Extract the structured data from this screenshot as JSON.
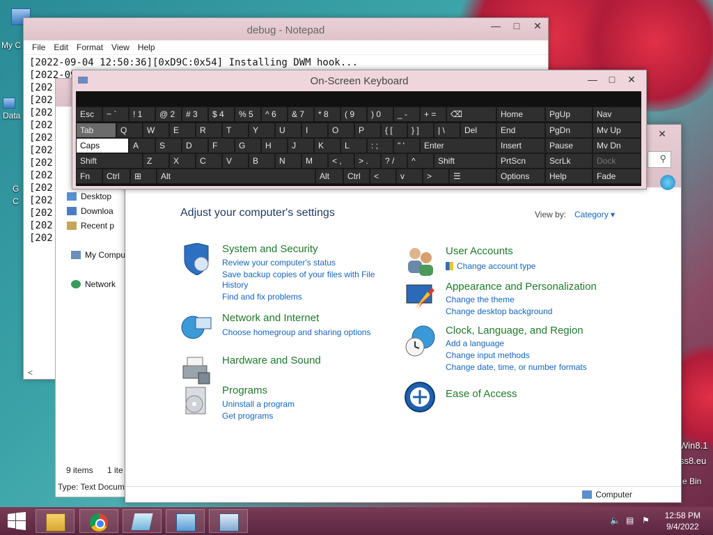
{
  "desktop": {
    "icons": [
      {
        "label": "My C"
      },
      {
        "label": "Data"
      },
      {
        "label": "G"
      },
      {
        "label": "C"
      }
    ],
    "side_text": [
      "Win8.1",
      "ss8.eu",
      "e Bin"
    ]
  },
  "notepad": {
    "title": "debug - Notepad",
    "menu": [
      "File",
      "Edit",
      "Format",
      "View",
      "Help"
    ],
    "lines": [
      "[2022-09-04 12:50:36][0xD9C:0x54] Installing DWM hook...",
      "[2022-09",
      "[202",
      "[202",
      "[202",
      "[202",
      "[202",
      "[202",
      "[202",
      "[202",
      "[202",
      "[202",
      "[202",
      "[202",
      "[202"
    ],
    "scroll_left": "<"
  },
  "explorer": {
    "nav": [
      "Desktop",
      "Downloa",
      "Recent p",
      "My Compu",
      "Network"
    ],
    "status_items": "9 items",
    "status_sel": "1 ite",
    "type_info": "Type: Text Docum"
  },
  "control_panel": {
    "heading": "Adjust your computer's settings",
    "view_by_label": "View by:",
    "view_by_value": "Category",
    "categories_left": [
      {
        "title": "System and Security",
        "links": [
          "Review your computer's status",
          "Save backup copies of your files with File",
          "History",
          "Find and fix problems"
        ]
      },
      {
        "title": "Network and Internet",
        "links": [
          "Choose homegroup and sharing options"
        ]
      },
      {
        "title": "Hardware and Sound",
        "links": []
      },
      {
        "title": "Programs",
        "links": [
          "Uninstall a program",
          "Get programs"
        ]
      }
    ],
    "categories_right": [
      {
        "title": "User Accounts",
        "links": [
          "Change account type"
        ]
      },
      {
        "title": "Appearance and Personalization",
        "links": [
          "Change the theme",
          "Change desktop background"
        ]
      },
      {
        "title": "Clock, Language, and Region",
        "links": [
          "Add a language",
          "Change input methods",
          "Change date, time, or number formats"
        ]
      },
      {
        "title": "Ease of Access",
        "links": []
      }
    ],
    "status_computer": "Computer"
  },
  "osk": {
    "title": "On-Screen Keyboard",
    "row1": [
      "Esc",
      "~ `",
      "! 1",
      "@ 2",
      "# 3",
      "$ 4",
      "% 5",
      "^ 6",
      "& 7",
      "* 8",
      "( 9",
      ") 0",
      "_ -",
      "+ ="
    ],
    "row2": [
      "Tab",
      "Q",
      "W",
      "E",
      "R",
      "T",
      "Y",
      "U",
      "I",
      "O",
      "P",
      "{ [",
      "} ]",
      "| \\",
      "Del"
    ],
    "row3": [
      "Caps",
      "A",
      "S",
      "D",
      "F",
      "G",
      "H",
      "J",
      "K",
      "L",
      ": ;",
      "\" '",
      "Enter"
    ],
    "row4": [
      "Shift",
      "Z",
      "X",
      "C",
      "V",
      "B",
      "N",
      "M",
      "< ,",
      "> .",
      "? /",
      "^",
      "Shift"
    ],
    "row5": [
      "Fn",
      "Ctrl",
      "⊞",
      "Alt",
      "Alt",
      "Ctrl",
      "<",
      "v",
      ">",
      "☰"
    ],
    "nav_keys": [
      "Home",
      "PgUp",
      "Nav",
      "End",
      "PgDn",
      "Mv Up",
      "Insert",
      "Pause",
      "Mv Dn",
      "PrtScn",
      "ScrLk",
      "Dock",
      "Options",
      "Help",
      "Fade"
    ]
  },
  "taskbar": {
    "time": "12:58 PM",
    "date": "9/4/2022"
  }
}
